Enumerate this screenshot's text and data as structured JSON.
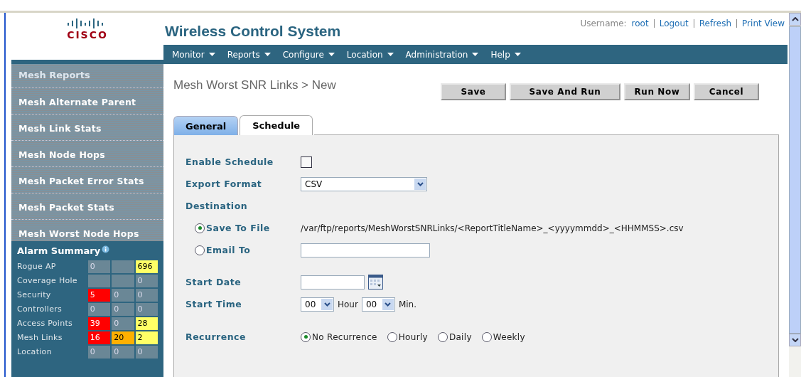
{
  "header": {
    "logo": "CISCO",
    "title": "Wireless Control System",
    "username_label": "Username:",
    "username": "root",
    "links": [
      "Logout",
      "Refresh",
      "Print View"
    ]
  },
  "menu": [
    "Monitor",
    "Reports",
    "Configure",
    "Location",
    "Administration",
    "Help"
  ],
  "sidebar": {
    "heading": "Mesh Reports",
    "items": [
      {
        "label": "Mesh Alternate Parent"
      },
      {
        "label": "Mesh Link Stats"
      },
      {
        "label": "Mesh Node Hops"
      },
      {
        "label": "Mesh Packet Error Stats"
      },
      {
        "label": "Mesh Packet Stats"
      },
      {
        "label": "Mesh Worst Node Hops"
      }
    ]
  },
  "alarm_summary": {
    "title": "Alarm Summary",
    "rows": [
      {
        "label": "Rogue AP",
        "cells": [
          {
            "value": "0",
            "color": "#6a8796"
          },
          {
            "color": "#6a8796"
          },
          {
            "value": "696",
            "color": "#ffff66"
          }
        ]
      },
      {
        "label": "Coverage Hole",
        "cells": [
          {
            "color": "#6a8796"
          },
          {
            "color": "#6a8796"
          },
          {
            "value": "0",
            "color": "#6a8796"
          }
        ]
      },
      {
        "label": "Security",
        "cells": [
          {
            "value": "5",
            "color": "#ff0000"
          },
          {
            "value": "0",
            "color": "#6a8796"
          },
          {
            "value": "0",
            "color": "#6a8796"
          }
        ]
      },
      {
        "label": "Controllers",
        "cells": [
          {
            "value": "0",
            "color": "#6a8796"
          },
          {
            "value": "0",
            "color": "#6a8796"
          },
          {
            "value": "0",
            "color": "#6a8796"
          }
        ]
      },
      {
        "label": "Access Points",
        "cells": [
          {
            "value": "39",
            "color": "#ff0000"
          },
          {
            "value": "0",
            "color": "#6a8796"
          },
          {
            "value": "28",
            "color": "#ffff66"
          }
        ]
      },
      {
        "label": "Mesh Links",
        "cells": [
          {
            "value": "16",
            "color": "#ff0000"
          },
          {
            "value": "20",
            "color": "#ffb000"
          },
          {
            "value": "2",
            "color": "#ffff66"
          }
        ]
      },
      {
        "label": "Location",
        "cells": [
          {
            "value": "0",
            "color": "#6a8796"
          },
          {
            "value": "0",
            "color": "#6a8796"
          },
          {
            "value": "0",
            "color": "#6a8796"
          }
        ]
      }
    ]
  },
  "page_title": "Mesh Worst SNR Links > New",
  "buttons": [
    "Save",
    "Save And Run",
    "Run Now",
    "Cancel"
  ],
  "tabs": [
    {
      "label": "General",
      "selected": false
    },
    {
      "label": "Schedule",
      "selected": true
    }
  ],
  "form": {
    "enable_schedule": {
      "label": "Enable Schedule",
      "checked": false
    },
    "export_format": {
      "label": "Export Format",
      "value": "CSV"
    },
    "destination": {
      "label": "Destination",
      "options": [
        {
          "label": "Save To File",
          "selected": true,
          "path": "/var/ftp/reports/MeshWorstSNRLinks/<ReportTitleName>_<yyyymmdd>_<HHMMSS>.csv"
        },
        {
          "label": "Email To",
          "selected": false
        }
      ]
    },
    "start_date": {
      "label": "Start Date"
    },
    "start_time": {
      "label": "Start Time",
      "hour": "00",
      "hour_unit": "Hour",
      "minute": "00",
      "minute_unit": "Min."
    },
    "recurrence": {
      "label": "Recurrence",
      "options": [
        {
          "label": "No Recurrence",
          "selected": true
        },
        {
          "label": "Hourly",
          "selected": false
        },
        {
          "label": "Daily",
          "selected": false
        },
        {
          "label": "Weekly",
          "selected": false
        }
      ]
    }
  }
}
